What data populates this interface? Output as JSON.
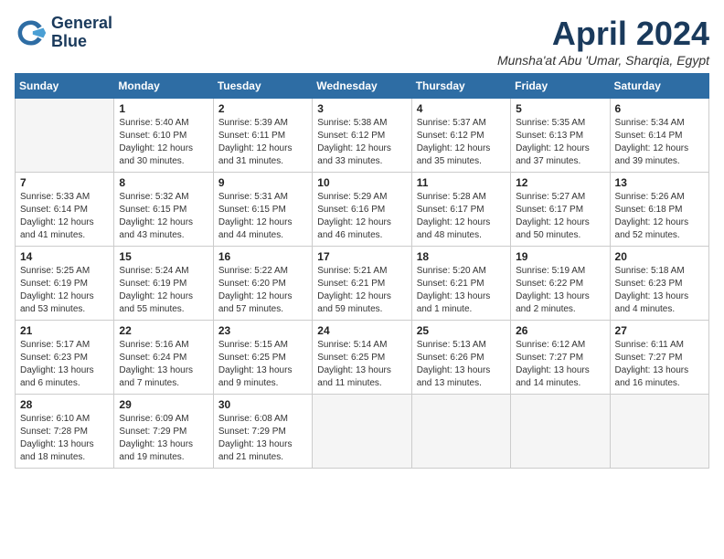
{
  "logo": {
    "line1": "General",
    "line2": "Blue"
  },
  "title": "April 2024",
  "subtitle": "Munsha'at Abu 'Umar, Sharqia, Egypt",
  "days_of_week": [
    "Sunday",
    "Monday",
    "Tuesday",
    "Wednesday",
    "Thursday",
    "Friday",
    "Saturday"
  ],
  "weeks": [
    [
      {
        "day": "",
        "empty": true
      },
      {
        "day": "1",
        "sunrise": "Sunrise: 5:40 AM",
        "sunset": "Sunset: 6:10 PM",
        "daylight": "Daylight: 12 hours and 30 minutes."
      },
      {
        "day": "2",
        "sunrise": "Sunrise: 5:39 AM",
        "sunset": "Sunset: 6:11 PM",
        "daylight": "Daylight: 12 hours and 31 minutes."
      },
      {
        "day": "3",
        "sunrise": "Sunrise: 5:38 AM",
        "sunset": "Sunset: 6:12 PM",
        "daylight": "Daylight: 12 hours and 33 minutes."
      },
      {
        "day": "4",
        "sunrise": "Sunrise: 5:37 AM",
        "sunset": "Sunset: 6:12 PM",
        "daylight": "Daylight: 12 hours and 35 minutes."
      },
      {
        "day": "5",
        "sunrise": "Sunrise: 5:35 AM",
        "sunset": "Sunset: 6:13 PM",
        "daylight": "Daylight: 12 hours and 37 minutes."
      },
      {
        "day": "6",
        "sunrise": "Sunrise: 5:34 AM",
        "sunset": "Sunset: 6:14 PM",
        "daylight": "Daylight: 12 hours and 39 minutes."
      }
    ],
    [
      {
        "day": "7",
        "sunrise": "Sunrise: 5:33 AM",
        "sunset": "Sunset: 6:14 PM",
        "daylight": "Daylight: 12 hours and 41 minutes."
      },
      {
        "day": "8",
        "sunrise": "Sunrise: 5:32 AM",
        "sunset": "Sunset: 6:15 PM",
        "daylight": "Daylight: 12 hours and 43 minutes."
      },
      {
        "day": "9",
        "sunrise": "Sunrise: 5:31 AM",
        "sunset": "Sunset: 6:15 PM",
        "daylight": "Daylight: 12 hours and 44 minutes."
      },
      {
        "day": "10",
        "sunrise": "Sunrise: 5:29 AM",
        "sunset": "Sunset: 6:16 PM",
        "daylight": "Daylight: 12 hours and 46 minutes."
      },
      {
        "day": "11",
        "sunrise": "Sunrise: 5:28 AM",
        "sunset": "Sunset: 6:17 PM",
        "daylight": "Daylight: 12 hours and 48 minutes."
      },
      {
        "day": "12",
        "sunrise": "Sunrise: 5:27 AM",
        "sunset": "Sunset: 6:17 PM",
        "daylight": "Daylight: 12 hours and 50 minutes."
      },
      {
        "day": "13",
        "sunrise": "Sunrise: 5:26 AM",
        "sunset": "Sunset: 6:18 PM",
        "daylight": "Daylight: 12 hours and 52 minutes."
      }
    ],
    [
      {
        "day": "14",
        "sunrise": "Sunrise: 5:25 AM",
        "sunset": "Sunset: 6:19 PM",
        "daylight": "Daylight: 12 hours and 53 minutes."
      },
      {
        "day": "15",
        "sunrise": "Sunrise: 5:24 AM",
        "sunset": "Sunset: 6:19 PM",
        "daylight": "Daylight: 12 hours and 55 minutes."
      },
      {
        "day": "16",
        "sunrise": "Sunrise: 5:22 AM",
        "sunset": "Sunset: 6:20 PM",
        "daylight": "Daylight: 12 hours and 57 minutes."
      },
      {
        "day": "17",
        "sunrise": "Sunrise: 5:21 AM",
        "sunset": "Sunset: 6:21 PM",
        "daylight": "Daylight: 12 hours and 59 minutes."
      },
      {
        "day": "18",
        "sunrise": "Sunrise: 5:20 AM",
        "sunset": "Sunset: 6:21 PM",
        "daylight": "Daylight: 13 hours and 1 minute."
      },
      {
        "day": "19",
        "sunrise": "Sunrise: 5:19 AM",
        "sunset": "Sunset: 6:22 PM",
        "daylight": "Daylight: 13 hours and 2 minutes."
      },
      {
        "day": "20",
        "sunrise": "Sunrise: 5:18 AM",
        "sunset": "Sunset: 6:23 PM",
        "daylight": "Daylight: 13 hours and 4 minutes."
      }
    ],
    [
      {
        "day": "21",
        "sunrise": "Sunrise: 5:17 AM",
        "sunset": "Sunset: 6:23 PM",
        "daylight": "Daylight: 13 hours and 6 minutes."
      },
      {
        "day": "22",
        "sunrise": "Sunrise: 5:16 AM",
        "sunset": "Sunset: 6:24 PM",
        "daylight": "Daylight: 13 hours and 7 minutes."
      },
      {
        "day": "23",
        "sunrise": "Sunrise: 5:15 AM",
        "sunset": "Sunset: 6:25 PM",
        "daylight": "Daylight: 13 hours and 9 minutes."
      },
      {
        "day": "24",
        "sunrise": "Sunrise: 5:14 AM",
        "sunset": "Sunset: 6:25 PM",
        "daylight": "Daylight: 13 hours and 11 minutes."
      },
      {
        "day": "25",
        "sunrise": "Sunrise: 5:13 AM",
        "sunset": "Sunset: 6:26 PM",
        "daylight": "Daylight: 13 hours and 13 minutes."
      },
      {
        "day": "26",
        "sunrise": "Sunrise: 6:12 AM",
        "sunset": "Sunset: 7:27 PM",
        "daylight": "Daylight: 13 hours and 14 minutes."
      },
      {
        "day": "27",
        "sunrise": "Sunrise: 6:11 AM",
        "sunset": "Sunset: 7:27 PM",
        "daylight": "Daylight: 13 hours and 16 minutes."
      }
    ],
    [
      {
        "day": "28",
        "sunrise": "Sunrise: 6:10 AM",
        "sunset": "Sunset: 7:28 PM",
        "daylight": "Daylight: 13 hours and 18 minutes."
      },
      {
        "day": "29",
        "sunrise": "Sunrise: 6:09 AM",
        "sunset": "Sunset: 7:29 PM",
        "daylight": "Daylight: 13 hours and 19 minutes."
      },
      {
        "day": "30",
        "sunrise": "Sunrise: 6:08 AM",
        "sunset": "Sunset: 7:29 PM",
        "daylight": "Daylight: 13 hours and 21 minutes."
      },
      {
        "day": "",
        "empty": true
      },
      {
        "day": "",
        "empty": true
      },
      {
        "day": "",
        "empty": true
      },
      {
        "day": "",
        "empty": true
      }
    ]
  ]
}
